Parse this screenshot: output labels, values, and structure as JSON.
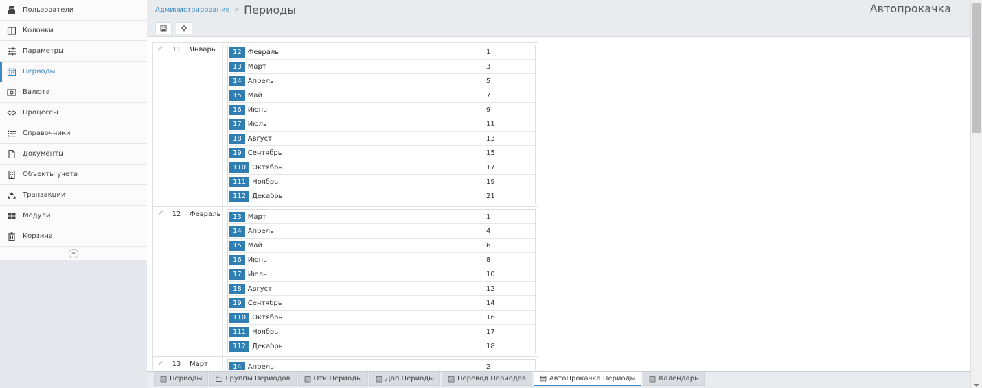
{
  "sidebar": {
    "items": [
      {
        "label": "Пользователи",
        "icon": "user-icon"
      },
      {
        "label": "Колонки",
        "icon": "columns-icon"
      },
      {
        "label": "Параметры",
        "icon": "sliders-icon"
      },
      {
        "label": "Периоды",
        "icon": "calendar-icon"
      },
      {
        "label": "Валюта",
        "icon": "money-icon"
      },
      {
        "label": "Процессы",
        "icon": "handshake-icon"
      },
      {
        "label": "Справочники",
        "icon": "list-icon"
      },
      {
        "label": "Документы",
        "icon": "document-icon"
      },
      {
        "label": "Объекты учета",
        "icon": "building-icon"
      },
      {
        "label": "Транзакции",
        "icon": "recycle-icon"
      },
      {
        "label": "Модули",
        "icon": "grid-icon"
      },
      {
        "label": "Корзина",
        "icon": "trash-icon"
      }
    ],
    "active_index": 3
  },
  "header": {
    "breadcrumb": "Администрирование",
    "separator": ">",
    "title": "Периоды",
    "right_title": "Автопрокачка"
  },
  "groups": [
    {
      "id": "11",
      "name": "Январь",
      "rows": [
        {
          "code": "12",
          "name": "Февраль",
          "value": "1"
        },
        {
          "code": "13",
          "name": "Март",
          "value": "3"
        },
        {
          "code": "14",
          "name": "Апрель",
          "value": "5"
        },
        {
          "code": "15",
          "name": "Май",
          "value": "7"
        },
        {
          "code": "16",
          "name": "Июнь",
          "value": "9"
        },
        {
          "code": "17",
          "name": "Июль",
          "value": "11"
        },
        {
          "code": "18",
          "name": "Август",
          "value": "13"
        },
        {
          "code": "19",
          "name": "Сентябрь",
          "value": "15"
        },
        {
          "code": "110",
          "name": "Октябрь",
          "value": "17"
        },
        {
          "code": "111",
          "name": "Ноябрь",
          "value": "19"
        },
        {
          "code": "112",
          "name": "Декабрь",
          "value": "21"
        }
      ]
    },
    {
      "id": "12",
      "name": "Февраль",
      "rows": [
        {
          "code": "13",
          "name": "Март",
          "value": "1"
        },
        {
          "code": "14",
          "name": "Апрель",
          "value": "4"
        },
        {
          "code": "15",
          "name": "Май",
          "value": "6"
        },
        {
          "code": "16",
          "name": "Июнь",
          "value": "8"
        },
        {
          "code": "17",
          "name": "Июль",
          "value": "10"
        },
        {
          "code": "18",
          "name": "Август",
          "value": "12"
        },
        {
          "code": "19",
          "name": "Сентябрь",
          "value": "14"
        },
        {
          "code": "110",
          "name": "Октябрь",
          "value": "16"
        },
        {
          "code": "111",
          "name": "Ноябрь",
          "value": "17"
        },
        {
          "code": "112",
          "name": "Декабрь",
          "value": "18"
        }
      ]
    },
    {
      "id": "13",
      "name": "Март",
      "rows": [
        {
          "code": "14",
          "name": "Апрель",
          "value": "2"
        }
      ]
    }
  ],
  "tabs": [
    {
      "label": "Периоды",
      "icon": "calendar-icon"
    },
    {
      "label": "Группы Периодов",
      "icon": "folder-icon"
    },
    {
      "label": "Отк.Периоды",
      "icon": "calendar-icon"
    },
    {
      "label": "Доп.Периоды",
      "icon": "calendar-icon"
    },
    {
      "label": "Перевод Периодов",
      "icon": "calendar-icon"
    },
    {
      "label": "АвтоПрокачка.Периоды",
      "icon": "calendar-icon"
    },
    {
      "label": "Календарь",
      "icon": "calendar-icon"
    }
  ],
  "active_tab_index": 5,
  "colors": {
    "accent": "#3b8ac4",
    "badge": "#2f7fb3"
  }
}
